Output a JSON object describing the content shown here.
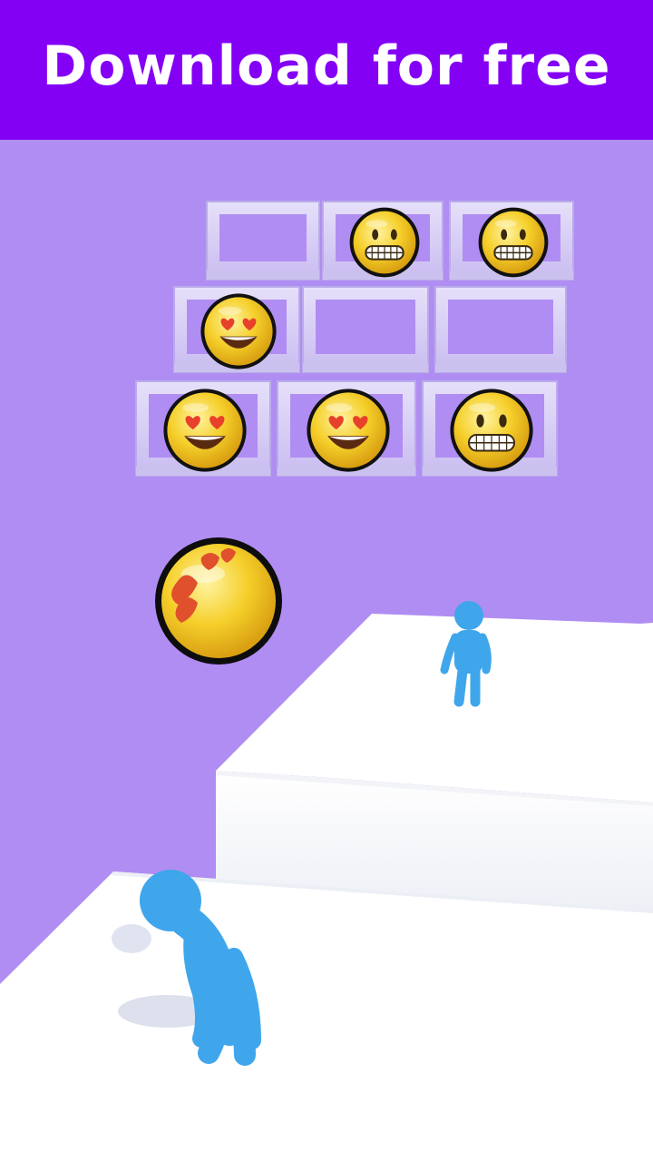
{
  "banner": {
    "text": "Download for free"
  },
  "colors": {
    "banner_bg": "#8300f5",
    "banner_text": "#ffffff",
    "scene_bg": "#b08df2",
    "frame": "#dcd4f5",
    "platform": "#ffffff",
    "emoji_face": "#f5cf2a",
    "stickman": "#3fa6ec"
  },
  "board": {
    "rows": 3,
    "cols": 3,
    "cells": [
      [
        "empty",
        "grimacing",
        "grimacing"
      ],
      [
        "heart-eyes",
        "empty",
        "empty"
      ],
      [
        "heart-eyes",
        "heart-eyes",
        "grimacing"
      ]
    ]
  },
  "held_ball": {
    "emoji": "heart-eyes"
  },
  "characters": [
    "player-stickman",
    "opponent-stickman"
  ]
}
